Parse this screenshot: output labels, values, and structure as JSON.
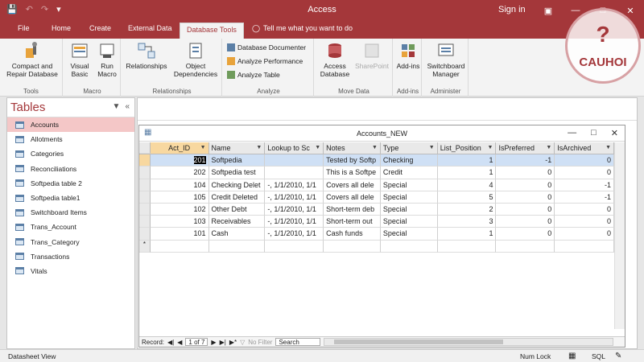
{
  "title": "Access",
  "signin": "Sign in",
  "tabs": [
    "File",
    "Home",
    "Create",
    "External Data",
    "Database Tools"
  ],
  "tellme": "Tell me what you want to do",
  "ribbon": {
    "tools": {
      "btn": "Compact and Repair Database",
      "label": "Tools"
    },
    "macro": {
      "vb": "Visual Basic",
      "run": "Run Macro",
      "label": "Macro"
    },
    "relationships": {
      "rel": "Relationships",
      "obj": "Object Dependencies",
      "label": "Relationships"
    },
    "analyze": {
      "doc": "Database Documenter",
      "perf": "Analyze Performance",
      "table": "Analyze Table",
      "label": "Analyze"
    },
    "move": {
      "access": "Access Database",
      "sp": "SharePoint",
      "label": "Move Data"
    },
    "addins": {
      "btn": "Add-ins",
      "label": "Add-ins"
    },
    "admin": {
      "btn": "Switchboard Manager",
      "label": "Administer"
    }
  },
  "nav": {
    "title": "Tables",
    "items": [
      "Accounts",
      "Allotments",
      "Categories",
      "Reconciliations",
      "Softpedia table 2",
      "Softpedia table1",
      "Switchboard Items",
      "Trans_Account",
      "Trans_Category",
      "Transactions",
      "Vitals"
    ],
    "selected": "Accounts"
  },
  "datasheet": {
    "title": "Accounts_NEW",
    "headers": [
      "Act_ID",
      "Name",
      "Lookup to Sc",
      "Notes",
      "Type",
      "List_Position",
      "IsPreferred",
      "IsArchived"
    ],
    "rows": [
      [
        "201",
        "Softpedia",
        "",
        "Tested by Softp",
        "Checking",
        "1",
        "-1",
        "0"
      ],
      [
        "202",
        "Softpedia test",
        "",
        "This is a Softpe",
        "Credit",
        "1",
        "0",
        "0"
      ],
      [
        "104",
        "Checking Delet",
        "-, 1/1/2010, 1/1",
        "Covers all dele",
        "Special",
        "4",
        "0",
        "-1"
      ],
      [
        "105",
        "Credit Deleted",
        "-, 1/1/2010, 1/1",
        "Covers all dele",
        "Special",
        "5",
        "0",
        "-1"
      ],
      [
        "102",
        "Other Debt",
        "-, 1/1/2010, 1/1",
        "Short-term deb",
        "Special",
        "2",
        "0",
        "0"
      ],
      [
        "103",
        "Receivables",
        "-, 1/1/2010, 1/1",
        "Short-term out",
        "Special",
        "3",
        "0",
        "0"
      ],
      [
        "101",
        "Cash",
        "-, 1/1/2010, 1/1",
        "Cash funds",
        "Special",
        "1",
        "0",
        "0"
      ]
    ],
    "new_row_marker": "*",
    "record_label": "Record:",
    "record_pos": "1 of 7",
    "no_filter": "No Filter",
    "search": "Search"
  },
  "status": {
    "left": "Datasheet View",
    "numlock": "Num Lock",
    "sql": "SQL"
  },
  "watermark": "CAUHOI"
}
